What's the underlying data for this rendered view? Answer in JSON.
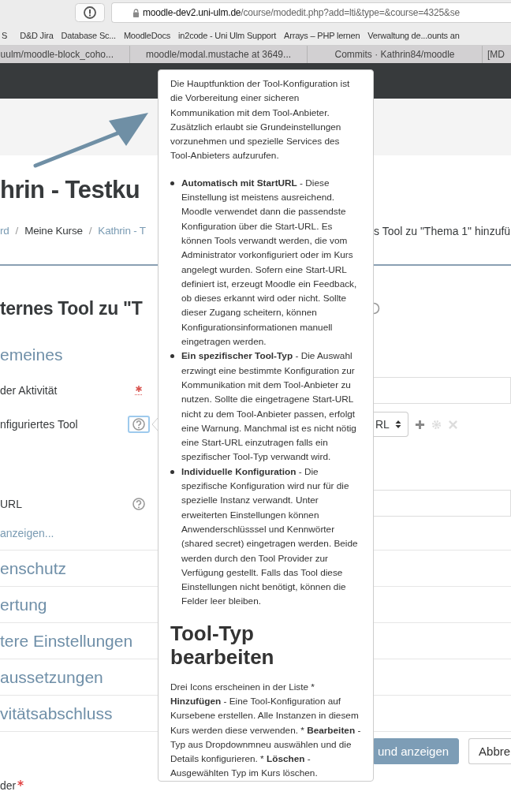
{
  "browser": {
    "url_host": "moodle-dev2.uni-ulm.de",
    "url_path": "/course/modedit.php?add=lti&type=&course=4325&se",
    "bookmarks": [
      "S",
      "D&D Jira",
      "Database Sc...",
      "MoodleDocs",
      "in2code - Uni Ulm Support",
      "Arrays – PHP lernen",
      "Verwaltung de...ounts an"
    ],
    "tabs": [
      {
        "label": "uulm/moodle-block_coho...",
        "selected": false
      },
      {
        "label": "moodle/modal.mustache at 3649...",
        "selected": false
      },
      {
        "label": "Commits · Kathrin84/moodle",
        "selected": false
      },
      {
        "label": "[MD",
        "selected": false
      }
    ]
  },
  "course_title": "hrin - Testku",
  "breadcrumb": [
    {
      "label": "rd",
      "kind": "link"
    },
    {
      "label": "/",
      "kind": "separator"
    },
    {
      "label": "Meine Kurse",
      "kind": "text"
    },
    {
      "label": "/",
      "kind": "separator"
    },
    {
      "label": "Kathrin - T",
      "kind": "link"
    }
  ],
  "breadcrumb_current": "s Tool zu \"Thema 1\" hinzufü",
  "page_heading": "ternes Tool zu \"T",
  "section_title": "emeines",
  "fields": [
    {
      "label": "der Aktivität",
      "required": true,
      "kind": "text"
    },
    {
      "label": "nfiguriertes Tool",
      "required": false,
      "help_focused": true,
      "kind": "select",
      "select_value": "RL"
    },
    {
      "label": "URL",
      "required": false,
      "help_focused": false,
      "kind": "text"
    }
  ],
  "more_link": "anzeigen...",
  "collapsed_sections": [
    "enschutz",
    "ertung",
    "tere Einstellungen",
    "aussetzungen",
    "vitätsabschluss"
  ],
  "buttons": [
    {
      "label": "und anzeigen",
      "kind": "primary"
    },
    {
      "label": "Abbre",
      "kind": "secondary"
    }
  ],
  "footer_label": {
    "text": "der",
    "required": true
  },
  "popover": {
    "intro": "Die Hauptfunktion der Tool-Konfiguration ist die Vorbereitung einer sicheren Kommunikation mit dem Tool-Anbieter. Zusätzlich erlaubt sie Grundeinstellungen vorzunehmen und spezielle Services des Tool-Anbieters aufzurufen.",
    "items": [
      "**Automatisch mit StartURL** - Diese Einstellung ist meistens ausreichend. Moodle verwendet dann die passendste Konfiguration über die Start-URL. Es können Tools verwandt werden, die vom Administrator vorkonfiguriert oder im Kurs angelegt wurden. Sofern eine Start-URL definiert ist, erzeugt Moodle ein Feedback, ob dieses erkannt wird oder nicht. Sollte dieser Zugang scheitern, können Konfigurationsinformationen manuell eingetragen werden.",
      "**Ein spezifischer Tool-Typ** - Die Auswahl erzwingt eine bestimmte Konfiguration zur Kommunikation mit dem Tool-Anbieter zu nutzen. Sollte die eingetragene Start-URL nicht zu dem Tool-Anbieter passen, erfolgt eine Warnung. Manchmal ist es nicht nötig eine Start-URL einzutragen falls ein spezifischer Tool-Typ verwandt wird.",
      "**Individuelle Konfiguration** - Die spezifische Konfiguration wird nur für die spezielle Instanz verwandt. Unter erweiterten Einstellungen können Anwenderschlüsssel und Kennwörter (shared secret) eingetragen werden. Beide werden durch den Tool Provider zur Verfügung gestellt. Falls das Tool diese Einstellungen nicht benötigt, können die Felder leer bleiben."
    ],
    "heading": "Tool-Typ bearbeiten",
    "body": "Drei Icons erscheinen in der Liste * **Hinzufügen** - Eine Tool-Konfiguration auf Kursebene erstellen. Alle Instanzen in diesem Kurs werden diese verwenden. * **Bearbeiten** - Typ aus Dropdownmneu auswählen und die Details konfigurieren. * **Löschen** - Ausgewählten Typ im Kurs löschen."
  }
}
